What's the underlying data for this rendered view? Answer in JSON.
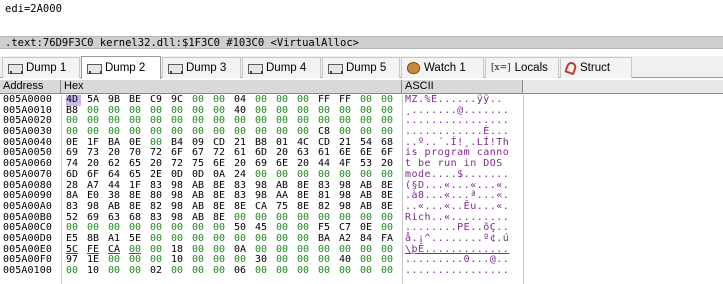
{
  "info": {
    "text": "edi=2A000"
  },
  "status": {
    "text": ".text:76D9F3C0 kernel32.dll:$1F3C0 #103C0 <VirtualAlloc>"
  },
  "tabs": [
    {
      "label": "Dump 1",
      "icon": "dump-icon",
      "active": false
    },
    {
      "label": "Dump 2",
      "icon": "dump-icon",
      "active": true
    },
    {
      "label": "Dump 3",
      "icon": "dump-icon",
      "active": false
    },
    {
      "label": "Dump 4",
      "icon": "dump-icon",
      "active": false
    },
    {
      "label": "Dump 5",
      "icon": "dump-icon",
      "active": false
    },
    {
      "label": "Watch 1",
      "icon": "watch-icon",
      "active": false
    },
    {
      "label": "Locals",
      "icon": "locals-icon",
      "icon_text": "[x=]",
      "active": false
    },
    {
      "label": "Struct",
      "icon": "struct-icon",
      "active": false
    }
  ],
  "dump": {
    "headers": {
      "address": "Address",
      "hex": "Hex",
      "ascii": "ASCII"
    },
    "rows": [
      {
        "addr": "005A0000",
        "hex": [
          "4D",
          "5A",
          "9B",
          "BE",
          "C9",
          "9C",
          "00",
          "00",
          "04",
          "00",
          "00",
          "00",
          "FF",
          "FF",
          "00",
          "00"
        ],
        "ascii": "MZ.%É......ÿÿ.."
      },
      {
        "addr": "005A0010",
        "hex": [
          "B8",
          "00",
          "00",
          "00",
          "00",
          "00",
          "00",
          "00",
          "40",
          "00",
          "00",
          "00",
          "00",
          "00",
          "00",
          "00"
        ],
        "ascii": "¸.......@......."
      },
      {
        "addr": "005A0020",
        "hex": [
          "00",
          "00",
          "00",
          "00",
          "00",
          "00",
          "00",
          "00",
          "00",
          "00",
          "00",
          "00",
          "00",
          "00",
          "00",
          "00"
        ],
        "ascii": "................"
      },
      {
        "addr": "005A0030",
        "hex": [
          "00",
          "00",
          "00",
          "00",
          "00",
          "00",
          "00",
          "00",
          "00",
          "00",
          "00",
          "00",
          "C8",
          "00",
          "00",
          "00"
        ],
        "ascii": "............È..."
      },
      {
        "addr": "005A0040",
        "hex": [
          "0E",
          "1F",
          "BA",
          "0E",
          "00",
          "B4",
          "09",
          "CD",
          "21",
          "B8",
          "01",
          "4C",
          "CD",
          "21",
          "54",
          "68"
        ],
        "ascii": "..º..´.Í!¸.LÍ!Th"
      },
      {
        "addr": "005A0050",
        "hex": [
          "69",
          "73",
          "20",
          "70",
          "72",
          "6F",
          "67",
          "72",
          "61",
          "6D",
          "20",
          "63",
          "61",
          "6E",
          "6E",
          "6F"
        ],
        "ascii": "is program canno"
      },
      {
        "addr": "005A0060",
        "hex": [
          "74",
          "20",
          "62",
          "65",
          "20",
          "72",
          "75",
          "6E",
          "20",
          "69",
          "6E",
          "20",
          "44",
          "4F",
          "53",
          "20"
        ],
        "ascii": "t be run in DOS "
      },
      {
        "addr": "005A0070",
        "hex": [
          "6D",
          "6F",
          "64",
          "65",
          "2E",
          "0D",
          "0D",
          "0A",
          "24",
          "00",
          "00",
          "00",
          "00",
          "00",
          "00",
          "00"
        ],
        "ascii": "mode....$......."
      },
      {
        "addr": "005A0080",
        "hex": [
          "28",
          "A7",
          "44",
          "1F",
          "83",
          "98",
          "AB",
          "8E",
          "83",
          "98",
          "AB",
          "8E",
          "83",
          "98",
          "AB",
          "8E"
        ],
        "ascii": "(§D...«...«...«."
      },
      {
        "addr": "005A0090",
        "hex": [
          "8A",
          "E0",
          "38",
          "8E",
          "80",
          "98",
          "AB",
          "8E",
          "83",
          "98",
          "AA",
          "8E",
          "81",
          "98",
          "AB",
          "8E"
        ],
        "ascii": ".à8...«...ª...«."
      },
      {
        "addr": "005A00A0",
        "hex": [
          "83",
          "98",
          "AB",
          "8E",
          "82",
          "98",
          "AB",
          "8E",
          "8E",
          "CA",
          "75",
          "8E",
          "82",
          "98",
          "AB",
          "8E"
        ],
        "ascii": "..«...«..Êu...«."
      },
      {
        "addr": "005A00B0",
        "hex": [
          "52",
          "69",
          "63",
          "68",
          "83",
          "98",
          "AB",
          "8E",
          "00",
          "00",
          "00",
          "00",
          "00",
          "00",
          "00",
          "00"
        ],
        "ascii": "Rich..«........."
      },
      {
        "addr": "005A00C0",
        "hex": [
          "00",
          "00",
          "00",
          "00",
          "00",
          "00",
          "00",
          "00",
          "50",
          "45",
          "00",
          "00",
          "F5",
          "C7",
          "0E",
          "00"
        ],
        "ascii": "........PE..õÇ.."
      },
      {
        "addr": "005A00D0",
        "hex": [
          "E5",
          "8B",
          "A1",
          "5E",
          "00",
          "00",
          "00",
          "00",
          "00",
          "00",
          "00",
          "00",
          "BA",
          "A2",
          "84",
          "FA"
        ],
        "ascii": "å.¡^........º¢.ú"
      },
      {
        "addr": "005A00E0",
        "hex": [
          "5C",
          "FE",
          "CA",
          "00",
          "00",
          "18",
          "00",
          "00",
          "0A",
          "00",
          "00",
          "00",
          "00",
          "00",
          "00",
          "00"
        ],
        "ascii": "\\þÊ............."
      },
      {
        "addr": "005A00F0",
        "hex": [
          "97",
          "1E",
          "00",
          "00",
          "00",
          "10",
          "00",
          "00",
          "00",
          "30",
          "00",
          "00",
          "00",
          "40",
          "00",
          "00"
        ],
        "ascii": ".........0...@.."
      },
      {
        "addr": "005A0100",
        "hex": [
          "00",
          "10",
          "00",
          "00",
          "02",
          "00",
          "00",
          "00",
          "06",
          "00",
          "00",
          "00",
          "00",
          "00",
          "00",
          "00"
        ],
        "ascii": "................"
      }
    ]
  },
  "colors": {
    "selection": "#c9b8f0",
    "zero_byte": "#1e8c1e",
    "ascii": "#7d2a8c",
    "header_bg": "#d9d9d9",
    "status_bg": "#cfcfcf"
  }
}
